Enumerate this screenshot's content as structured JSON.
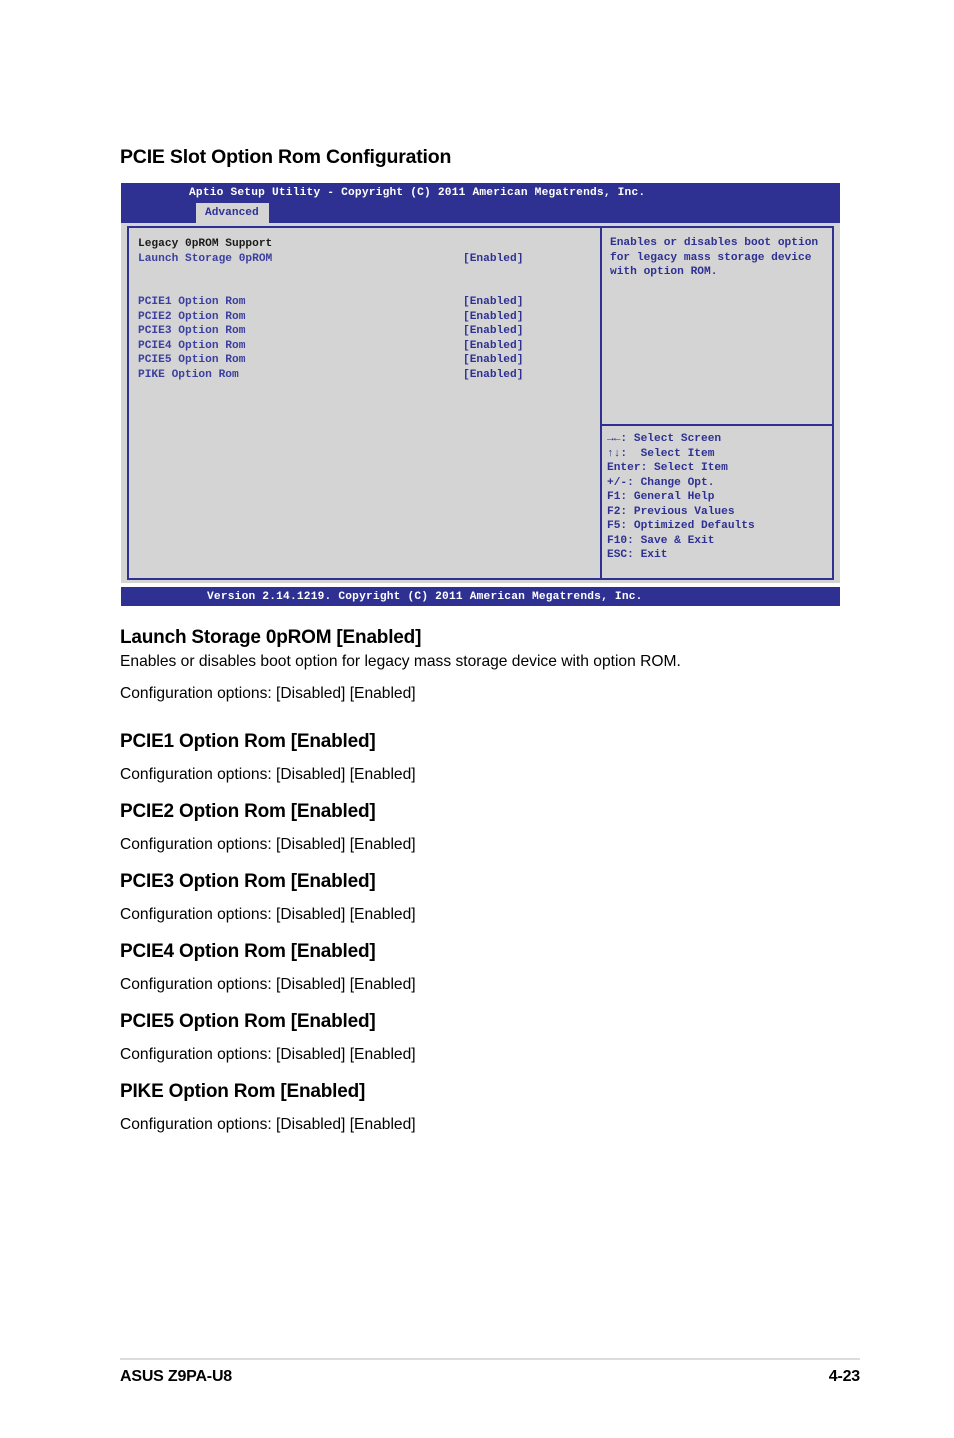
{
  "page": {
    "section_title": "PCIE Slot Option Rom Configuration",
    "footer_left": "ASUS Z9PA-U8",
    "footer_page": "4-23"
  },
  "bios": {
    "title": "Aptio Setup Utility - Copyright (C) 2011 American Megatrends, Inc.",
    "active_tab": "Advanced",
    "version_bar": "Version 2.14.1219. Copyright (C) 2011 American Megatrends, Inc.",
    "group_header": "Legacy 0pROM Support",
    "items": [
      {
        "label": "Launch Storage 0pROM",
        "value": "[Enabled]"
      },
      {
        "label": "PCIE1 Option Rom",
        "value": "[Enabled]"
      },
      {
        "label": "PCIE2 Option Rom",
        "value": "[Enabled]"
      },
      {
        "label": "PCIE3 Option Rom",
        "value": "[Enabled]"
      },
      {
        "label": "PCIE4 Option Rom",
        "value": "[Enabled]"
      },
      {
        "label": "PCIE5 Option Rom",
        "value": "[Enabled]"
      },
      {
        "label": "PIKE Option Rom",
        "value": "[Enabled]"
      }
    ],
    "help_text": "Enables or disables boot option for legacy mass storage device with option ROM.",
    "legend": [
      "→←: Select Screen",
      "↑↓:  Select Item",
      "Enter: Select Item",
      "+/-: Change Opt.",
      "F1: General Help",
      "F2: Previous Values",
      "F5: Optimized Defaults",
      "F10: Save & Exit",
      "ESC: Exit"
    ]
  },
  "entries": [
    {
      "title": "Launch Storage 0pROM [Enabled]",
      "desc": "Enables or disables boot option for legacy mass storage device with option ROM.",
      "config": "Configuration options: [Disabled] [Enabled]"
    },
    {
      "title": "PCIE1 Option Rom [Enabled]",
      "desc": "",
      "config": "Configuration options: [Disabled] [Enabled]"
    },
    {
      "title": "PCIE2 Option Rom [Enabled]",
      "desc": "",
      "config": "Configuration options: [Disabled] [Enabled]"
    },
    {
      "title": "PCIE3 Option Rom [Enabled]",
      "desc": "",
      "config": "Configuration options: [Disabled] [Enabled]"
    },
    {
      "title": "PCIE4 Option Rom [Enabled]",
      "desc": "",
      "config": "Configuration options: [Disabled] [Enabled]"
    },
    {
      "title": "PCIE5 Option Rom [Enabled]",
      "desc": "",
      "config": "Configuration options: [Disabled] [Enabled]"
    },
    {
      "title": "PIKE Option Rom [Enabled]",
      "desc": "",
      "config": "Configuration options: [Disabled] [Enabled]"
    }
  ],
  "colors": {
    "bios_blue": "#2e3192",
    "bios_gray": "#d4d4d4"
  }
}
